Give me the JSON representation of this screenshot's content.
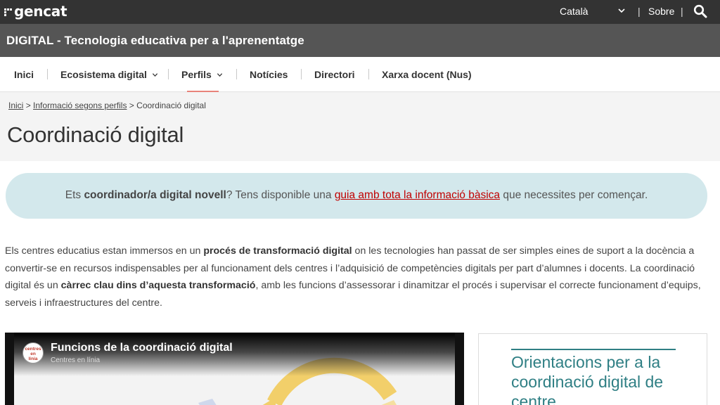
{
  "topbar": {
    "logo": "gencat",
    "language": "Català",
    "separator": "|",
    "about": "Sobre"
  },
  "site": {
    "title": "DIGITAL - Tecnologia educativa per a l'aprenentatge"
  },
  "nav": {
    "items": [
      {
        "label": "Inici"
      },
      {
        "label": "Ecosistema digital"
      },
      {
        "label": "Perfils"
      },
      {
        "label": "Notícies"
      },
      {
        "label": "Directori"
      },
      {
        "label": "Xarxa docent (Nus)"
      }
    ]
  },
  "breadcrumb": {
    "items": [
      "Inici",
      "Informació segons perfils",
      "Coordinació digital"
    ],
    "separator": ">"
  },
  "page": {
    "title": "Coordinació digital"
  },
  "callout": {
    "part1": "Ets ",
    "bold": "coordinador/a digital novell",
    "part2": "? Tens disponible una ",
    "link": "guia amb tota la informació bàsica",
    "part3": " que necessites per començar."
  },
  "body": {
    "t1": "Els centres educatius estan immersos en un ",
    "b1": "procés de transformació digital",
    "t2": " on les tecnologies han passat de ser simples eines de suport a la docència a convertir-se en recursos indispensables per al funcionament dels centres i l’adquisició de competències digitals per part d’alumnes i docents. La coordinació digital és un ",
    "b2": "càrrec clau dins d’aquesta transformació",
    "t3": ", amb les funcions d’assessorar i dinamitzar el procés i supervisar el correcte funcionament d’equips, serveis i infraestructures del centre."
  },
  "video": {
    "title": "Funcions de la coordinació digital",
    "channel": "Centres en línia",
    "logo_lines": [
      "centres",
      "en",
      "línia"
    ]
  },
  "card": {
    "title": "Orientacions per a la coordinació digital de centre"
  },
  "colors": {
    "topbar": "#333333",
    "sitebar": "#555555",
    "accent_nav": "#e8837a",
    "callout_bg": "#d3e8ec",
    "link": "#c00000",
    "card_title": "#2f7f84"
  },
  "icons": {
    "search": "search-icon",
    "language_dropdown": "chevron-down-icon",
    "menu_dropdown": "chevron-down-icon"
  }
}
